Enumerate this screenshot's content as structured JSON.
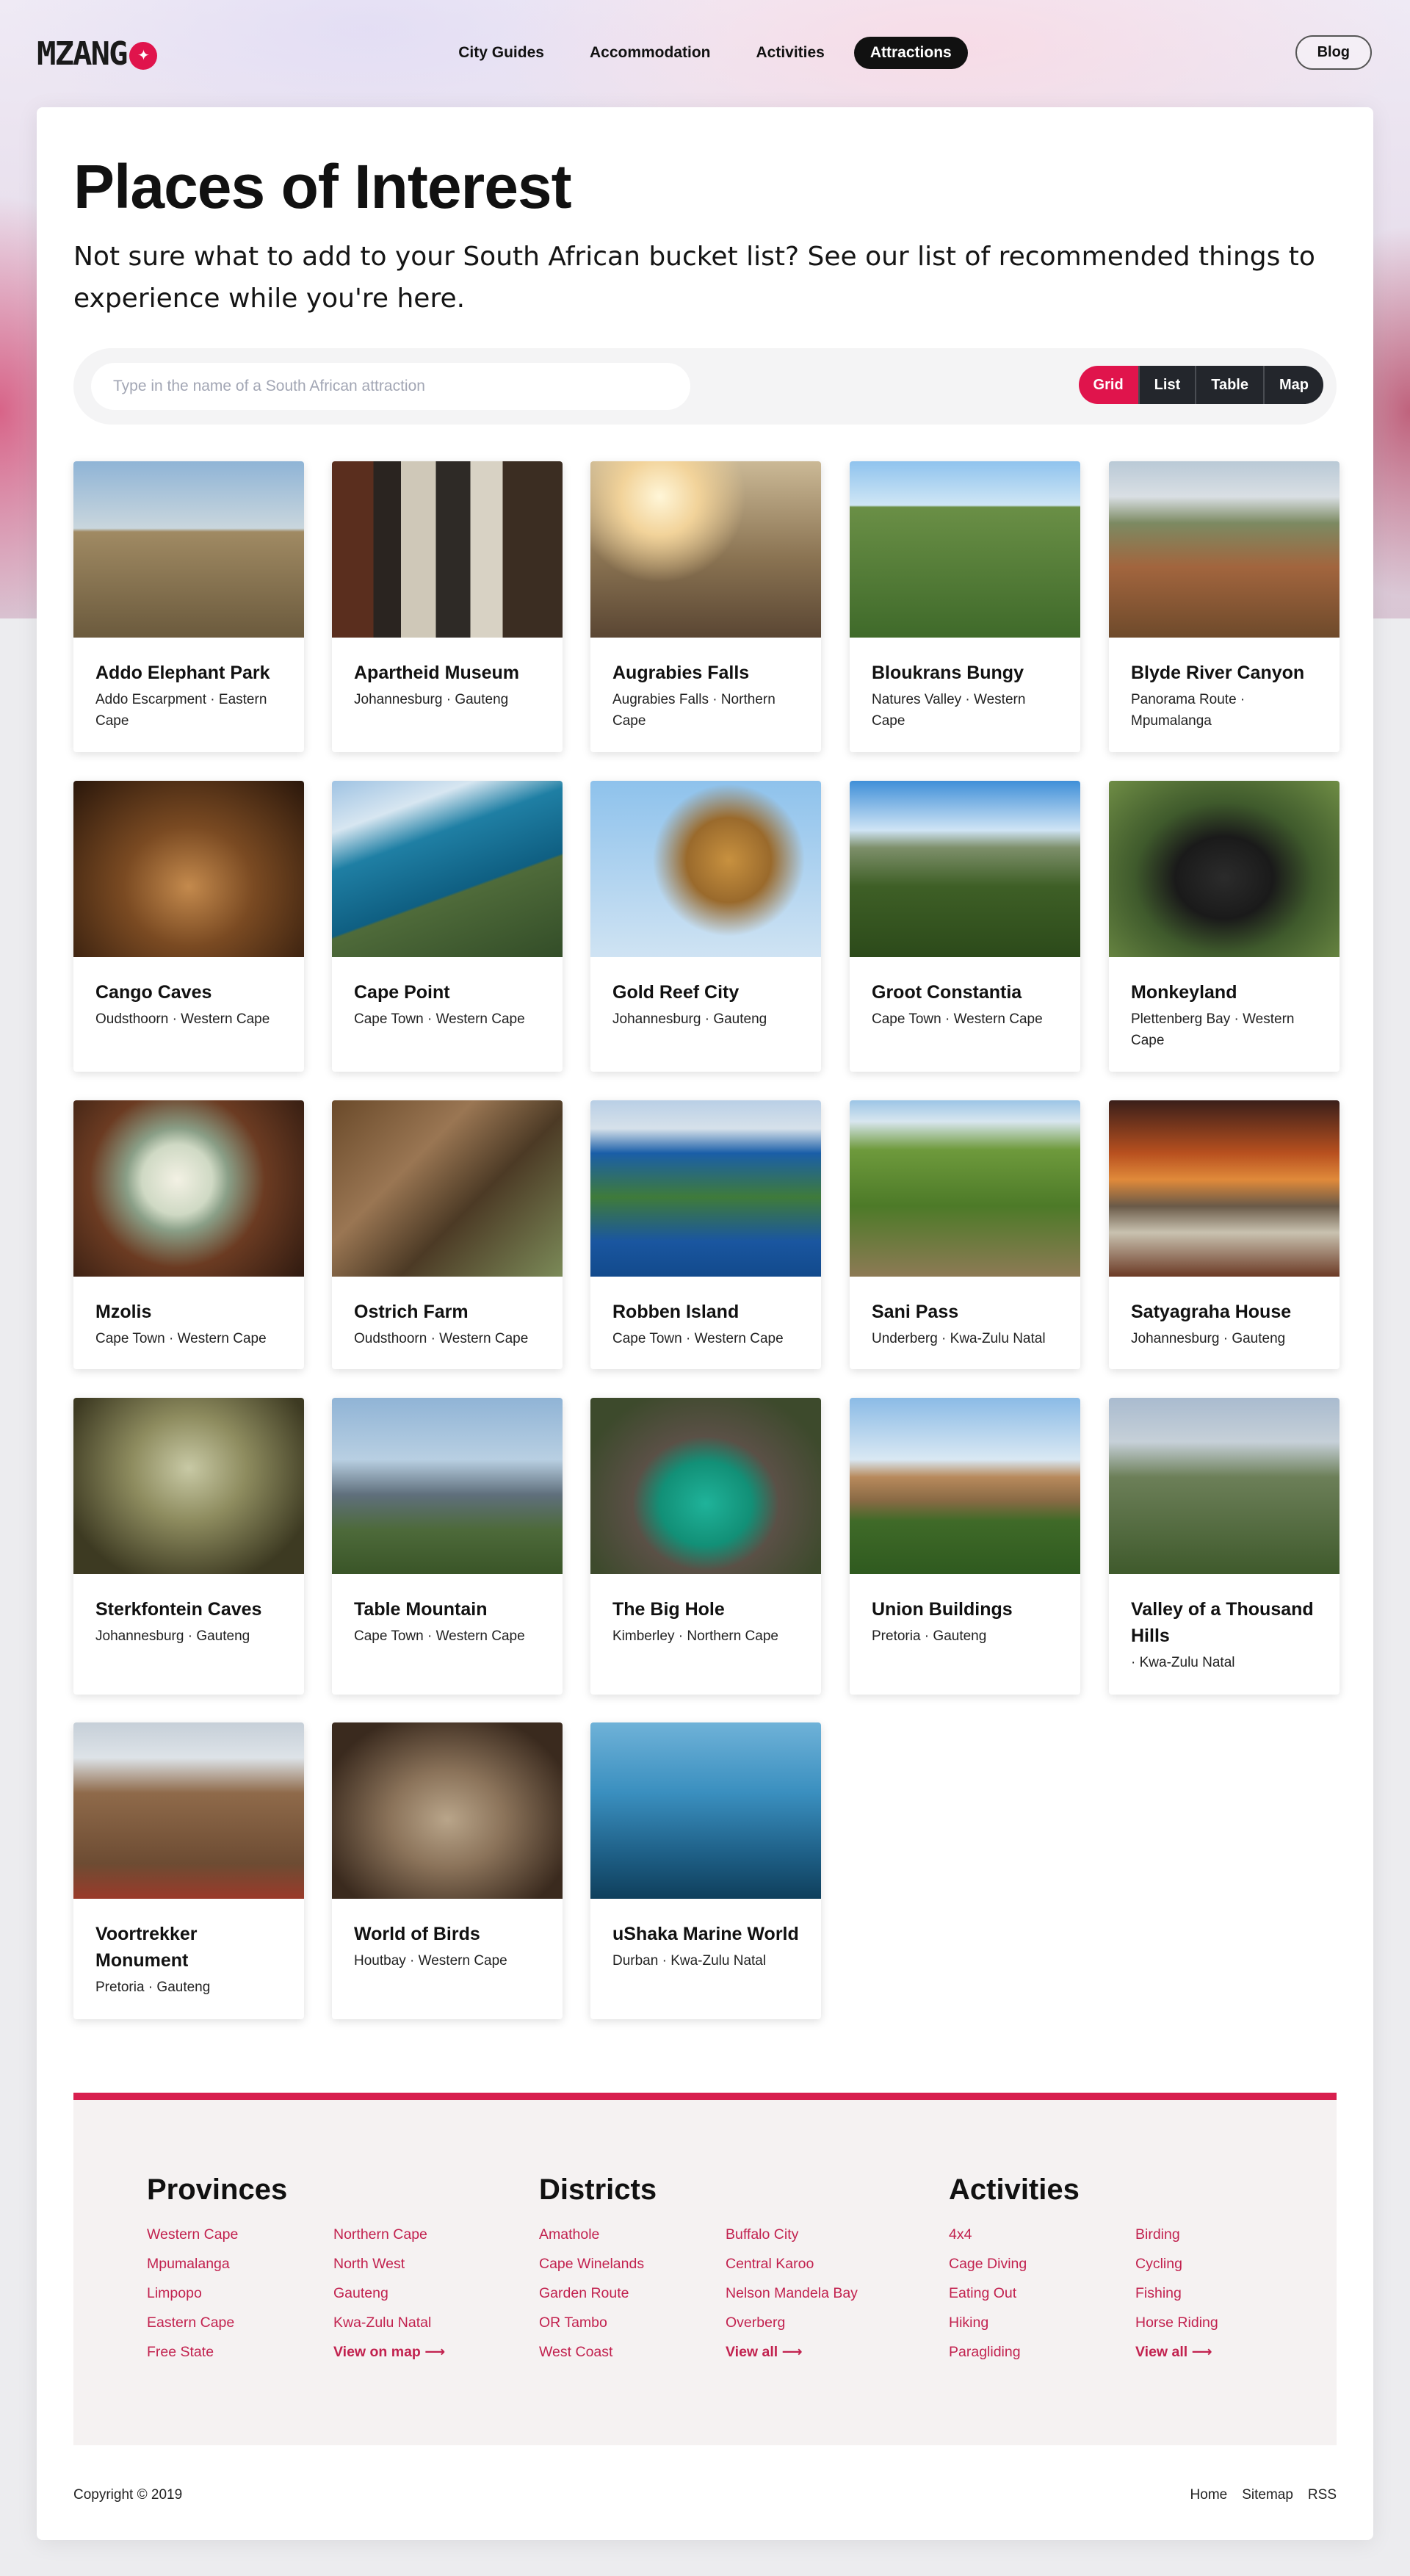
{
  "header": {
    "logo_text": "MZANGO",
    "nav": [
      {
        "label": "City Guides",
        "active": false
      },
      {
        "label": "Accommodation",
        "active": false
      },
      {
        "label": "Activities",
        "active": false
      },
      {
        "label": "Attractions",
        "active": true
      }
    ],
    "blog_label": "Blog"
  },
  "main": {
    "title": "Places of Interest",
    "intro": "Not sure what to add to your South African bucket list? See our list of recommended things to experience while you're here.",
    "search_placeholder": "Type in the name of a South African attraction",
    "views": [
      "Grid",
      "List",
      "Table",
      "Map"
    ],
    "selected_view": "Grid"
  },
  "attractions": [
    {
      "name": "Addo Elephant Park",
      "location": "Addo Escarpment · Eastern Cape",
      "image": "elephants"
    },
    {
      "name": "Apartheid Museum",
      "location": "Johannesburg · Gauteng",
      "image": "museum-wall"
    },
    {
      "name": "Augrabies Falls",
      "location": "Augrabies Falls · Northern Cape",
      "image": "canyon-viewer"
    },
    {
      "name": "Bloukrans Bungy",
      "location": "Natures Valley · Western Cape",
      "image": "arch-bridge"
    },
    {
      "name": "Blyde River Canyon",
      "location": "Panorama Route · Mpumalanga",
      "image": "canyon"
    },
    {
      "name": "Cango Caves",
      "location": "Oudsthoorn · Western Cape",
      "image": "cave"
    },
    {
      "name": "Cape Point",
      "location": "Cape Town · Western Cape",
      "image": "coast"
    },
    {
      "name": "Gold Reef City",
      "location": "Johannesburg · Gauteng",
      "image": "swing-ride"
    },
    {
      "name": "Groot Constantia",
      "location": "Cape Town · Western Cape",
      "image": "vineyard"
    },
    {
      "name": "Monkeyland",
      "location": "Plettenberg Bay · Western Cape",
      "image": "monkey"
    },
    {
      "name": "Mzolis",
      "location": "Cape Town · Western Cape",
      "image": "food"
    },
    {
      "name": "Ostrich Farm",
      "location": "Oudsthoorn · Western Cape",
      "image": "ostrich"
    },
    {
      "name": "Robben Island",
      "location": "Cape Town · Western Cape",
      "image": "island"
    },
    {
      "name": "Sani Pass",
      "location": "Underberg · Kwa-Zulu Natal",
      "image": "mountain-pass"
    },
    {
      "name": "Satyagraha House",
      "location": "Johannesburg · Gauteng",
      "image": "thatched-house"
    },
    {
      "name": "Sterkfontein Caves",
      "location": "Johannesburg · Gauteng",
      "image": "green-cave"
    },
    {
      "name": "Table Mountain",
      "location": "Cape Town · Western Cape",
      "image": "table-mountain"
    },
    {
      "name": "The Big Hole",
      "location": "Kimberley · Northern Cape",
      "image": "big-hole"
    },
    {
      "name": "Union Buildings",
      "location": "Pretoria · Gauteng",
      "image": "union-buildings"
    },
    {
      "name": "Valley of a Thousand Hills",
      "location": "· Kwa-Zulu Natal",
      "image": "hills"
    },
    {
      "name": "Voortrekker Monument",
      "location": "Pretoria · Gauteng",
      "image": "monument"
    },
    {
      "name": "World of Birds",
      "location": "Houtbay · Western Cape",
      "image": "owl"
    },
    {
      "name": "uShaka Marine World",
      "location": "Durban · Kwa-Zulu Natal",
      "image": "shark"
    }
  ],
  "footer": {
    "columns": [
      {
        "title": "Provinces",
        "links": [
          "Western Cape",
          "Northern Cape",
          "Mpumalanga",
          "North West",
          "Limpopo",
          "Gauteng",
          "Eastern Cape",
          "Kwa-Zulu Natal",
          "Free State",
          "View on map ⟶"
        ]
      },
      {
        "title": "Districts",
        "links": [
          "Amathole",
          "Buffalo City",
          "Cape Winelands",
          "Central Karoo",
          "Garden Route",
          "Nelson Mandela Bay",
          "OR Tambo",
          "Overberg",
          "West Coast",
          "View all ⟶"
        ]
      },
      {
        "title": "Activities",
        "links": [
          "4x4",
          "Birding",
          "Cage Diving",
          "Cycling",
          "Eating Out",
          "Fishing",
          "Hiking",
          "Horse Riding",
          "Paragliding",
          "View all ⟶"
        ]
      }
    ],
    "copyright": "Copyright © 2019",
    "bottom_links": [
      "Home",
      "Sitemap",
      "RSS"
    ]
  },
  "colors": {
    "accent": "#e0144c",
    "footer_link": "#c2224f",
    "dark": "#23262c"
  }
}
